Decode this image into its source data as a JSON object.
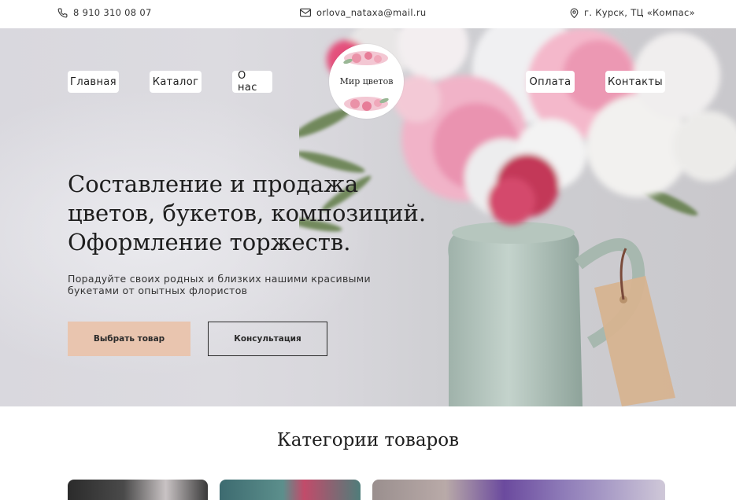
{
  "contacts": {
    "phone": "8 910 310 08 07",
    "email": "orlova_nataxa@mail.ru",
    "address": "г. Курск, ТЦ «Компас»"
  },
  "nav": {
    "left": [
      "Главная",
      "Каталог",
      "О нас"
    ],
    "right": [
      "Оплата",
      "Контакты"
    ]
  },
  "logo": {
    "text": "Мир цветов"
  },
  "hero": {
    "title_lines": [
      "Составление и продажа",
      "цветов, букетов, композиций.",
      "Оформление торжеств."
    ],
    "subtitle_lines": [
      "Порадуйте своих родных и близких нашими красивыми",
      "букетами от опытных флористов"
    ],
    "primary_button": "Выбрать товар",
    "secondary_button": "Консультация"
  },
  "categories": {
    "title": "Категории товаров"
  },
  "colors": {
    "accent": "#e9c5af",
    "text": "#1e1e1e"
  },
  "icons": {
    "phone": "phone-icon",
    "email": "mail-icon",
    "address": "map-pin-icon"
  }
}
